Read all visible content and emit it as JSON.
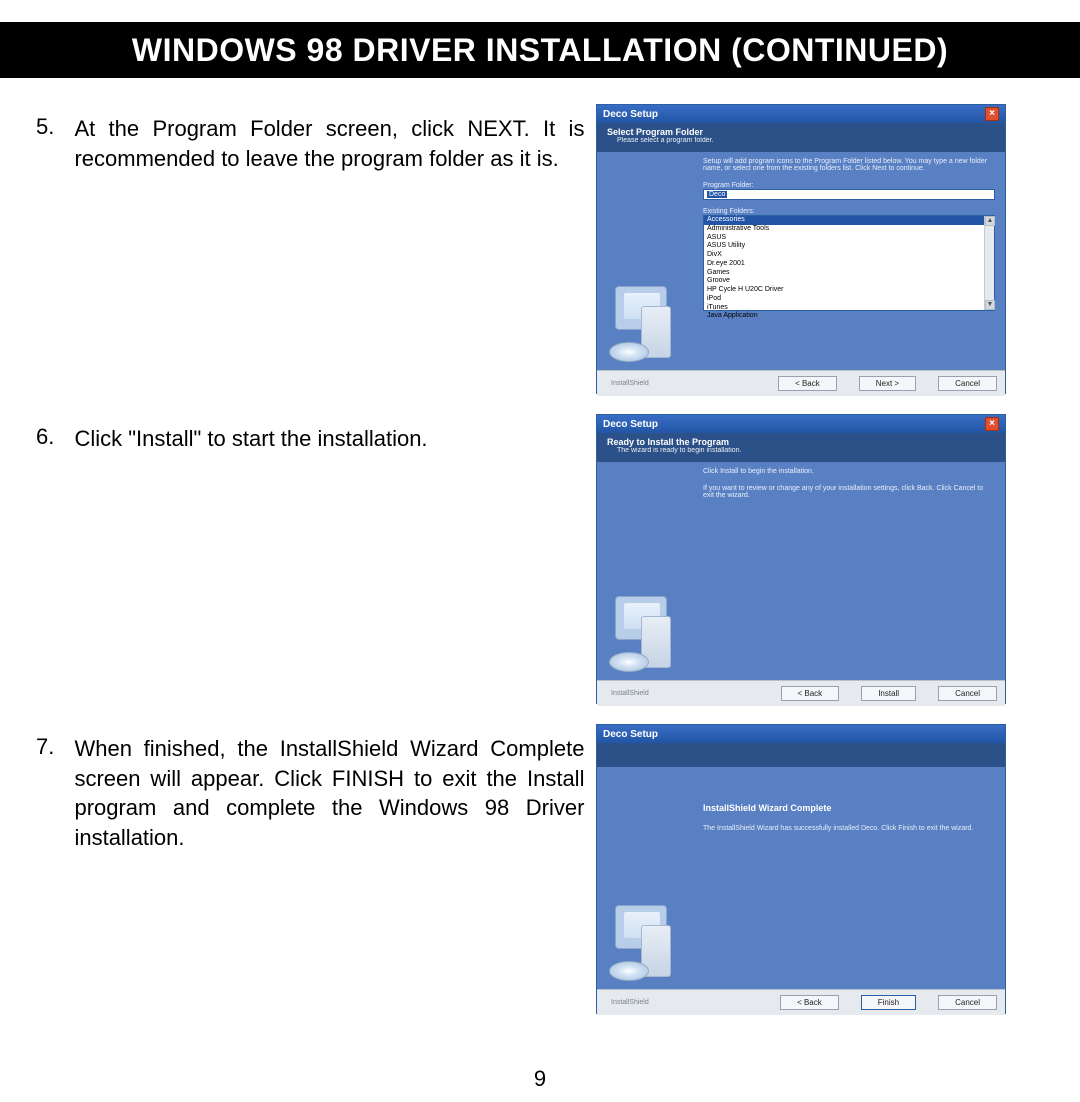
{
  "title": "WINDOWS 98 DRIVER INSTALLATION (CONTINUED)",
  "page_number": "9",
  "steps": [
    {
      "num": "5.",
      "text": "At the Program Folder screen, click NEXT. It is recommended to leave the program folder as it is."
    },
    {
      "num": "6.",
      "text": "Click \"Install\" to start the installation."
    },
    {
      "num": "7.",
      "text": "When finished, the InstallShield Wizard Complete screen will appear. Click FINISH to exit the Install program and complete the Windows 98 Driver installation."
    }
  ],
  "screenshot1": {
    "window_title": "Deco Setup",
    "header_title": "Select Program Folder",
    "header_sub": "Please select a program folder.",
    "intro": "Setup will add program icons to the Program Folder listed below. You may type a new folder name, or select one from the existing folders list. Click Next to continue.",
    "program_folder_label": "Program Folder:",
    "program_folder_value": "Deco",
    "existing_label": "Existing Folders:",
    "existing": [
      "Accessories",
      "Administrative Tools",
      "ASUS",
      "ASUS Utility",
      "DivX",
      "Dr.eye 2001",
      "Games",
      "Groove",
      "HP Cycle H U20C Driver",
      "iPod",
      "iTunes",
      "Java Application"
    ],
    "btn_back": "< Back",
    "btn_next": "Next >",
    "btn_cancel": "Cancel",
    "footer_brand": "InstallShield"
  },
  "screenshot2": {
    "window_title": "Deco Setup",
    "header_title": "Ready to Install the Program",
    "header_sub": "The wizard is ready to begin installation.",
    "line1": "Click Install to begin the installation.",
    "line2": "If you want to review or change any of your installation settings, click Back. Click Cancel to exit the wizard.",
    "btn_back": "< Back",
    "btn_install": "Install",
    "btn_cancel": "Cancel",
    "footer_brand": "InstallShield"
  },
  "screenshot3": {
    "window_title": "Deco Setup",
    "complete_title": "InstallShield Wizard Complete",
    "complete_text": "The InstallShield Wizard has successfully installed Deco. Click Finish to exit the wizard.",
    "btn_back": "< Back",
    "btn_finish": "Finish",
    "btn_cancel": "Cancel",
    "footer_brand": "InstallShield"
  }
}
